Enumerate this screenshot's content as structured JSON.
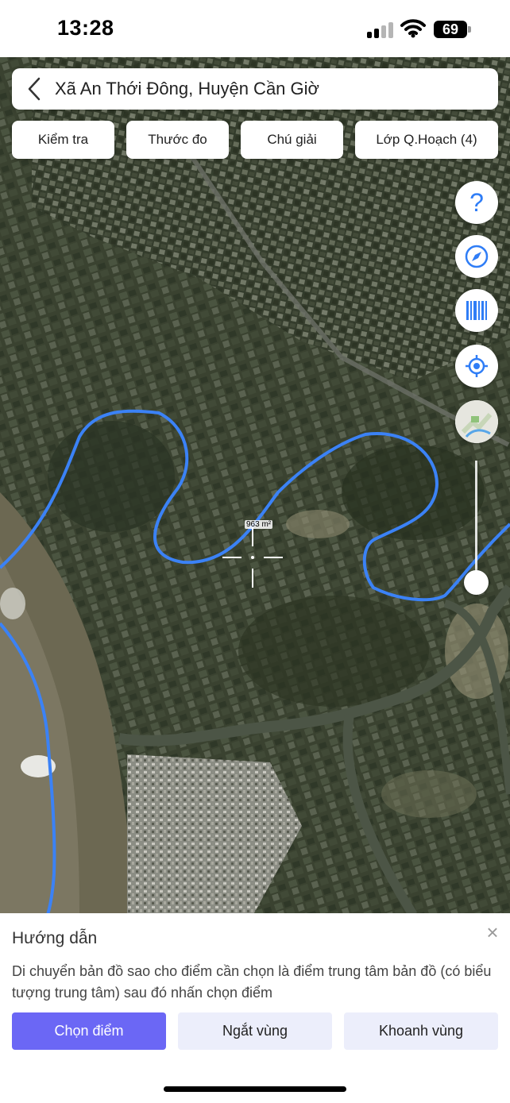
{
  "status_bar": {
    "time": "13:28",
    "battery": "69"
  },
  "header": {
    "location_title": "Xã An Thới Đông, Huyện Cần Giờ"
  },
  "toolbar": {
    "check_label": "Kiểm tra",
    "measure_label": "Thước đo",
    "legend_label": "Chú giải",
    "layers_label": "Lớp Q.Hoạch (4)"
  },
  "map": {
    "area_label": "963 m²",
    "help_symbol": "?",
    "boundary_color": "#3b82f6",
    "zoom_level": 0.15
  },
  "sheet": {
    "title": "Hướng dẫn",
    "close_symbol": "×",
    "description": "Di chuyển bản đồ sao cho điểm cần chọn là điểm trung tâm bản đồ (có biểu tượng trung tâm) sau đó nhấn chọn điểm",
    "buttons": {
      "pick_point": "Chọn điểm",
      "break_region": "Ngắt vùng",
      "draw_region": "Khoanh vùng"
    }
  },
  "icons": [
    "back-arrow-icon",
    "help-icon",
    "compass-icon",
    "barcode-icon",
    "locate-icon",
    "layer-thumbnail-icon",
    "crosshair-icon",
    "close-icon"
  ]
}
